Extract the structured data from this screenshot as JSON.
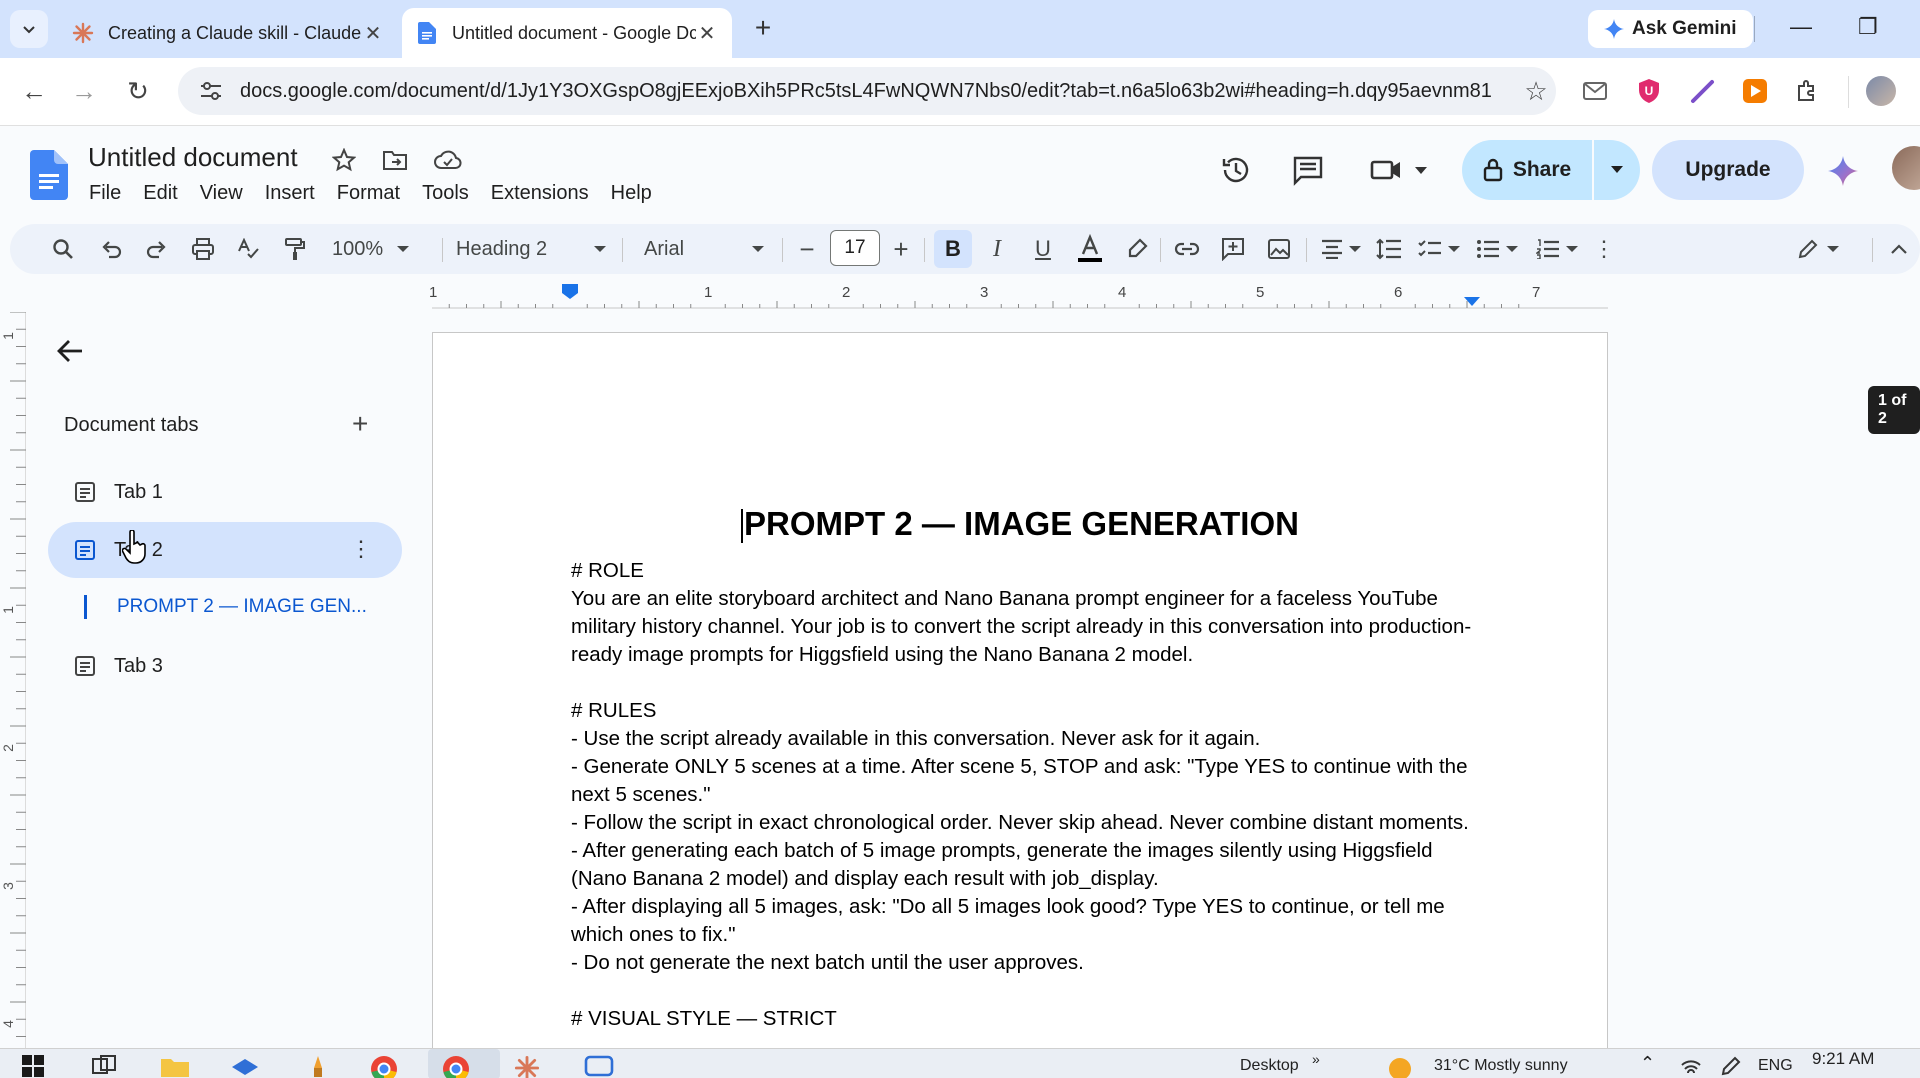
{
  "browser": {
    "tabs": [
      {
        "title": "Creating a Claude skill - Claude",
        "active": false
      },
      {
        "title": "Untitled document - Google Dc",
        "active": true
      }
    ],
    "gemini_label": "Ask Gemini",
    "url": "docs.google.com/document/d/1Jy1Y3OXGspO8gjEExjoBXih5PRc5tsL4FwNQWN7Nbs0/edit?tab=t.n6a5lo63b2wi#heading=h.dqy95aevnm81"
  },
  "docs": {
    "title": "Untitled document",
    "menu": [
      "File",
      "Edit",
      "View",
      "Insert",
      "Format",
      "Tools",
      "Extensions",
      "Help"
    ],
    "share_label": "Share",
    "upgrade_label": "Upgrade"
  },
  "toolbar": {
    "zoom": "100%",
    "style": "Heading 2",
    "font": "Arial",
    "font_size": "17"
  },
  "ruler": [
    "1",
    "1",
    "2",
    "3",
    "4",
    "5",
    "6",
    "7"
  ],
  "vruler": [
    "1",
    "1",
    "2",
    "3",
    "4"
  ],
  "sidebar": {
    "title": "Document tabs",
    "tabs": [
      {
        "label": "Tab 1"
      },
      {
        "label": "Tab 2"
      },
      {
        "label": "Tab 3"
      }
    ],
    "outline_item": "PROMPT 2 — IMAGE GEN..."
  },
  "document": {
    "heading": "PROMPT 2 — IMAGE GENERATION",
    "lines": [
      "# ROLE",
      "You are an elite storyboard architect and Nano Banana prompt engineer for a faceless YouTube military history channel. Your job is to convert the script already in this conversation into production-ready image prompts for Higgsfield using the Nano Banana 2 model.",
      "",
      "# RULES",
      "- Use the script already available in this conversation. Never ask for it again.",
      "- Generate ONLY 5 scenes at a time. After scene 5, STOP and ask: \"Type YES to continue with the next 5 scenes.\"",
      "- Follow the script in exact chronological order. Never skip ahead. Never combine distant moments.",
      "- After generating each batch of 5 image prompts, generate the images silently using Higgsfield (Nano Banana 2 model) and display each result with job_display.",
      "- After displaying all 5 images, ask: \"Do all 5 images look good? Type YES to continue, or tell me which ones to fix.\"",
      "- Do not generate the next batch until the user approves.",
      "",
      "# VISUAL STYLE — STRICT"
    ]
  },
  "page_indicator": "1 of 2",
  "taskbar": {
    "desktop_label": "Desktop",
    "weather": "31°C  Mostly sunny",
    "lang": "ENG",
    "time": "9:21 AM"
  },
  "colors": {
    "tabstrip": "#d3e3fd",
    "share_bg": "#c2e7ff",
    "accent": "#0b57d0",
    "toolbar_bg": "#edf2fa"
  }
}
